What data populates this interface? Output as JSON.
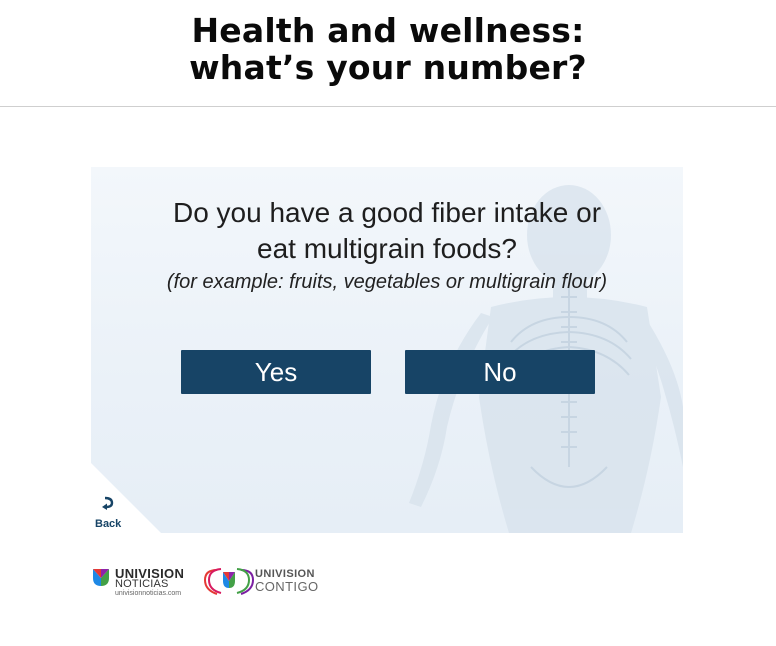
{
  "header": {
    "title_line1": "Health and wellness:",
    "title_line2": "what’s your number?"
  },
  "quiz": {
    "question_line1": "Do you have a good fiber intake or",
    "question_line2": "eat multigrain foods?",
    "hint": "(for example: fruits, vegetables or multigrain flour)",
    "yes_label": "Yes",
    "no_label": "No",
    "back_label": "Back"
  },
  "footer": {
    "logo1_brand": "UNIVISION",
    "logo1_sub": "NOTICIAS",
    "logo1_url": "univisionnoticias.com",
    "logo2_brand": "UNIVISION",
    "logo2_sub": "CONTIGO"
  },
  "colors": {
    "button_bg": "#174466",
    "button_text": "#ffffff",
    "card_bg": "#eef4fa",
    "divider": "#cfcfcf"
  },
  "icons": [
    "back-arrow-icon",
    "univision-noticias-logo",
    "univision-contigo-logo"
  ]
}
